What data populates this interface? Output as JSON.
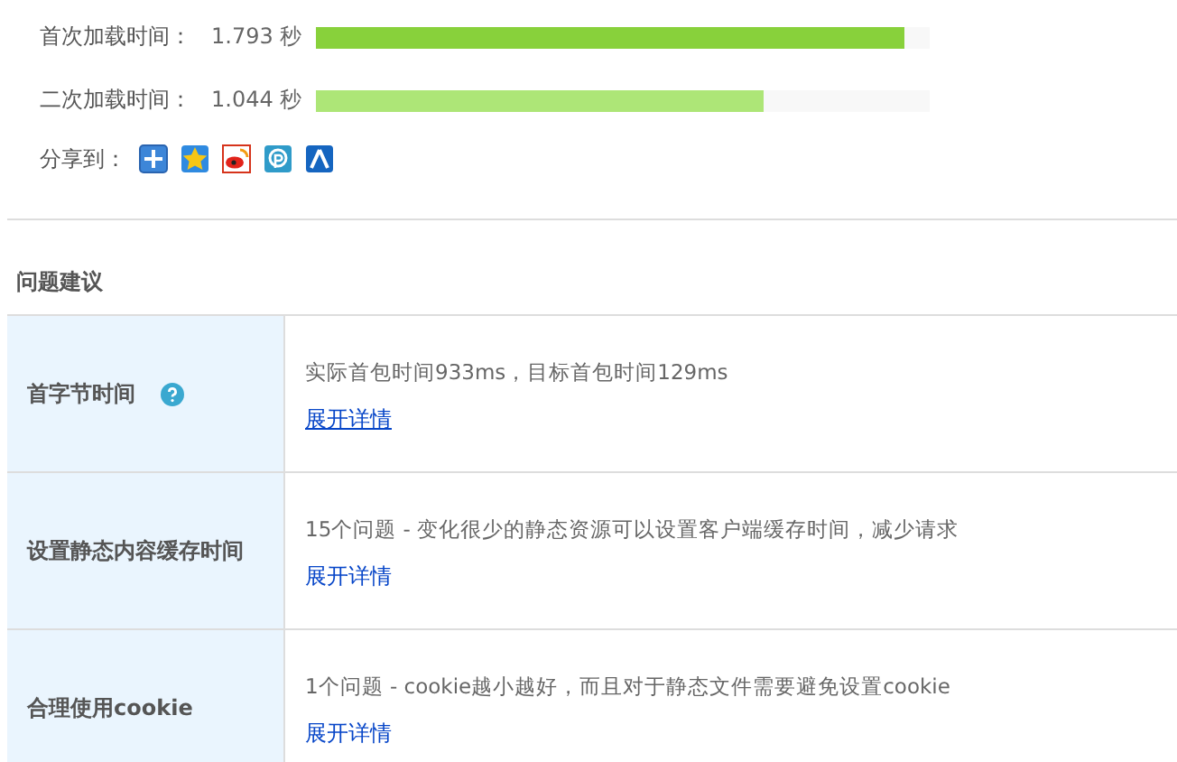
{
  "metrics": [
    {
      "label": "首次加载时间：",
      "value": "1.793 秒",
      "level": 0.96,
      "color": "#88d13b"
    },
    {
      "label": "二次加载时间：",
      "value": "1.044 秒",
      "level": 0.73,
      "color": "#ade677"
    }
  ],
  "share": {
    "label": "分享到：",
    "services": [
      {
        "kind": "plus"
      },
      {
        "kind": "star"
      },
      {
        "kind": "weibo"
      },
      {
        "kind": "p"
      },
      {
        "kind": "person"
      }
    ]
  },
  "section_title": "问题建议",
  "issues": [
    {
      "name": "首字节时间",
      "help": true,
      "summary": "实际首包时间933ms，目标首包时间129ms",
      "link": "展开详情",
      "underlined": true
    },
    {
      "name": "设置静态内容缓存时间",
      "help": false,
      "summary": "15个问题 - 变化很少的静态资源可以设置客户端缓存时间，减少请求",
      "link": "展开详情",
      "underlined": false
    },
    {
      "name": "合理使用cookie",
      "help": false,
      "summary": "1个问题 - cookie越小越好，而且对于静态文件需要避免设置cookie",
      "link": "展开详情",
      "underlined": false
    }
  ]
}
